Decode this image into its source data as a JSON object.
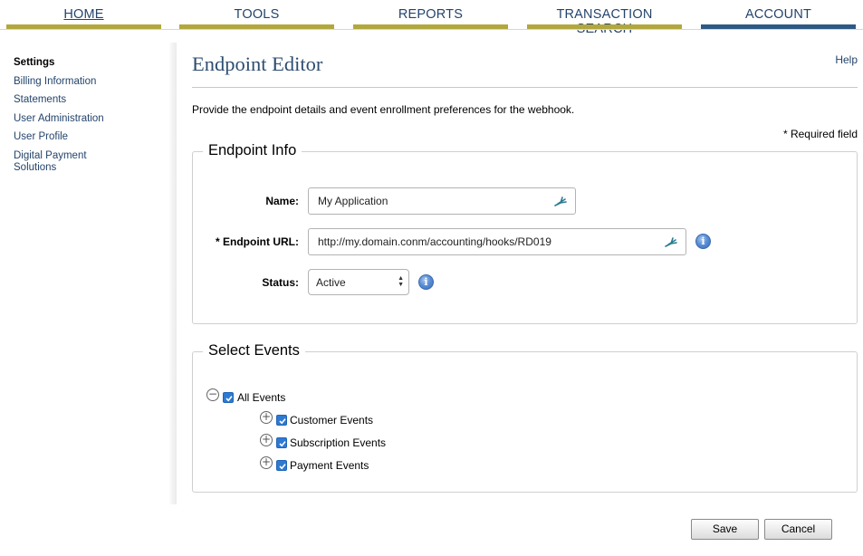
{
  "nav": {
    "tabs": [
      {
        "label": "HOME"
      },
      {
        "label": "TOOLS"
      },
      {
        "label": "REPORTS"
      },
      {
        "label": "TRANSACTION SEARCH"
      },
      {
        "label": "ACCOUNT"
      }
    ],
    "active": "ACCOUNT",
    "colors": {
      "tab_bar": "#b2a73c",
      "active_bar": "#2c5a84",
      "link": "#24446b"
    }
  },
  "sidebar": {
    "items": [
      {
        "label": "Settings"
      },
      {
        "label": "Billing Information"
      },
      {
        "label": "Statements"
      },
      {
        "label": "User Administration"
      },
      {
        "label": "User Profile"
      },
      {
        "label": "Digital Payment Solutions"
      }
    ],
    "active": "Settings"
  },
  "page": {
    "title": "Endpoint Editor",
    "help": "Help",
    "intro": "Provide the endpoint details and event enrollment preferences for the webhook.",
    "required_note": "* Required field"
  },
  "endpoint_info": {
    "legend": "Endpoint Info",
    "name_label": "Name:",
    "name_value": "My Application",
    "url_label": "* Endpoint URL:",
    "url_value": "http://my.domain.conm/accounting/hooks/RD019",
    "status_label": "Status:",
    "status_value": "Active"
  },
  "select_events": {
    "legend": "Select Events",
    "root": {
      "label": "All Events",
      "checked": true,
      "expanded": true
    },
    "children": [
      {
        "label": "Customer Events",
        "checked": true,
        "expanded": false
      },
      {
        "label": "Subscription Events",
        "checked": true,
        "expanded": false
      },
      {
        "label": "Payment Events",
        "checked": true,
        "expanded": false
      }
    ]
  },
  "actions": {
    "save": "Save",
    "cancel": "Cancel"
  },
  "icons": {
    "edit": "pen-icon",
    "info": "info-icon",
    "collapse": "minus-circle-icon",
    "expand": "plus-circle-icon"
  }
}
